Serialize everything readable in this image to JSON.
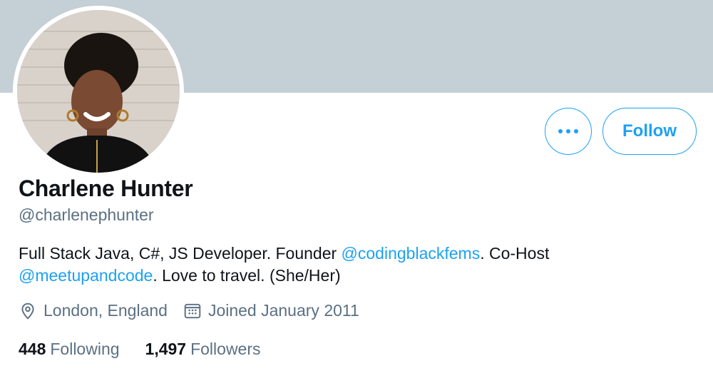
{
  "profile": {
    "name": "Charlene Hunter",
    "handle": "@charlenephunter",
    "bio": {
      "part1": "Full Stack Java, C#, JS Developer. Founder ",
      "mention1": "@codingblackfems",
      "part2": ". Co-Host ",
      "mention2": "@meetupandcode",
      "part3": ". Love to travel. (She/Her)"
    },
    "location": "London, England",
    "joined": "Joined January 2011"
  },
  "stats": {
    "following_count": "448",
    "following_label": "Following",
    "followers_count": "1,497",
    "followers_label": "Followers"
  },
  "actions": {
    "follow_label": "Follow"
  },
  "icons": {
    "more": "more-dots-icon",
    "location": "location-pin-icon",
    "calendar": "calendar-icon"
  },
  "colors": {
    "accent": "#1da1f2",
    "banner": "#c4cfd6",
    "secondary_text": "#5b7083",
    "primary_text": "#0f1419"
  }
}
